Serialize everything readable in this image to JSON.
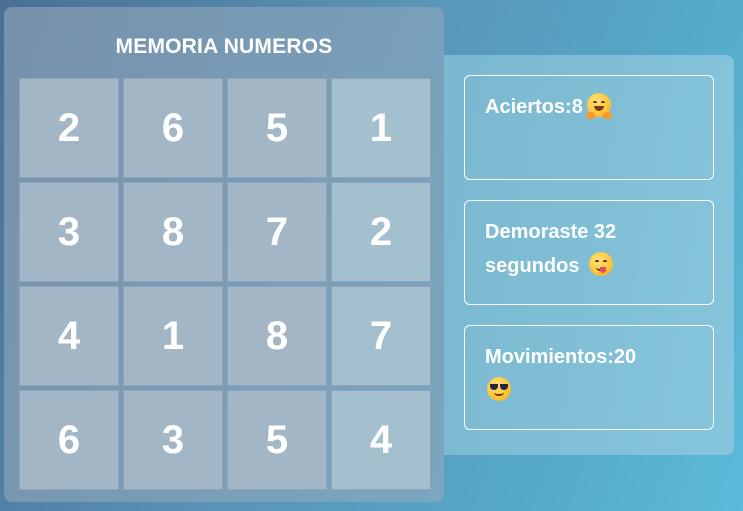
{
  "board": {
    "title": "MEMORIA NUMEROS",
    "cells": [
      "2",
      "6",
      "5",
      "1",
      "3",
      "8",
      "7",
      "2",
      "4",
      "1",
      "8",
      "7",
      "6",
      "3",
      "5",
      "4"
    ]
  },
  "stats": {
    "hits_label": "Aciertos:8",
    "hits_emoji": "smiling-face-with-hugging-hands-icon",
    "time_label": "Demoraste 32 segundos",
    "time_emoji": "face-savoring-food-icon",
    "moves_label": "Movimientos:20",
    "moves_emoji": "smiling-face-with-sunglasses-icon"
  }
}
